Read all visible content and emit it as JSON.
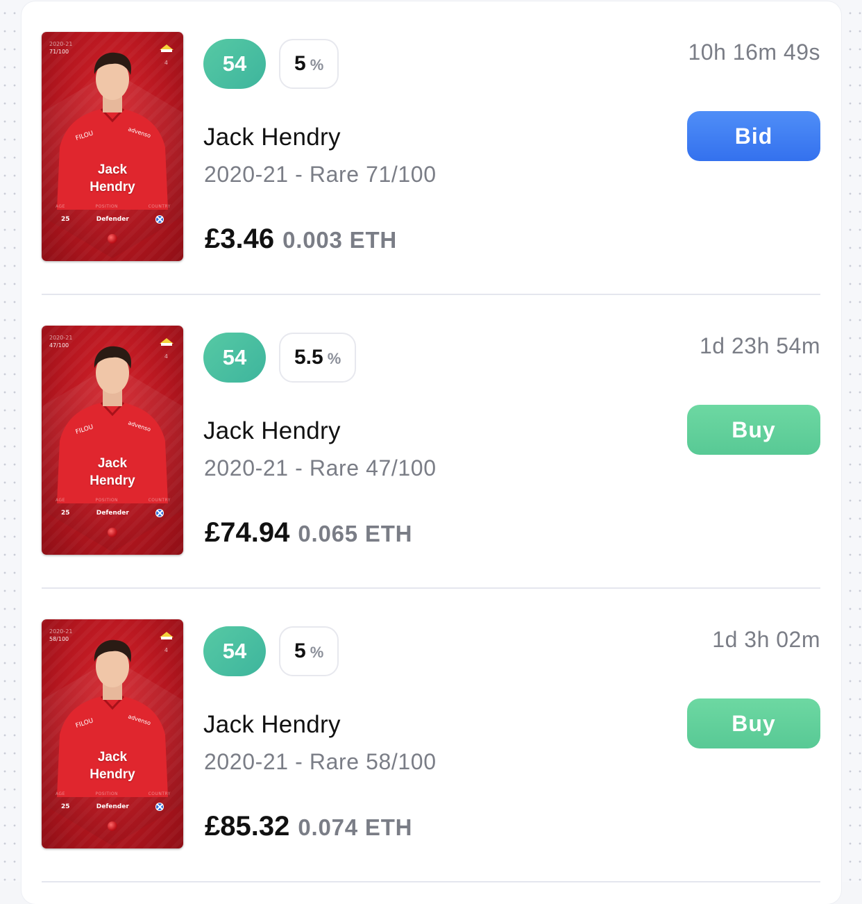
{
  "listings": [
    {
      "card": {
        "season": "2020-21",
        "serial": "71/100",
        "jersey_number": "4",
        "first_name": "Jack",
        "last_name": "Hendry",
        "age_label": "AGE",
        "position_label": "POSITION",
        "country_label": "COUNTRY",
        "age": "25",
        "position": "Defender",
        "color": "#c0161f"
      },
      "score": "54",
      "bonus": "5",
      "bonus_icon": "percent-icon",
      "name": "Jack Hendry",
      "edition": "2020-21 - Rare 71/100",
      "price_gbp": "£3.46",
      "price_eth": "0.003 ETH",
      "time_left": "10h 16m 49s",
      "action": "Bid",
      "action_type": "bid"
    },
    {
      "card": {
        "season": "2020-21",
        "serial": "47/100",
        "jersey_number": "4",
        "first_name": "Jack",
        "last_name": "Hendry",
        "age_label": "AGE",
        "position_label": "POSITION",
        "country_label": "COUNTRY",
        "age": "25",
        "position": "Defender",
        "color": "#c0161f"
      },
      "score": "54",
      "bonus": "5.5",
      "bonus_icon": "percent-icon",
      "name": "Jack Hendry",
      "edition": "2020-21 - Rare 47/100",
      "price_gbp": "£74.94",
      "price_eth": "0.065 ETH",
      "time_left": "1d 23h 54m",
      "action": "Buy",
      "action_type": "buy"
    },
    {
      "card": {
        "season": "2020-21",
        "serial": "58/100",
        "jersey_number": "4",
        "first_name": "Jack",
        "last_name": "Hendry",
        "age_label": "AGE",
        "position_label": "POSITION",
        "country_label": "COUNTRY",
        "age": "25",
        "position": "Defender",
        "color": "#c0161f"
      },
      "score": "54",
      "bonus": "5",
      "bonus_icon": "percent-icon",
      "name": "Jack Hendry",
      "edition": "2020-21 - Rare 58/100",
      "price_gbp": "£85.32",
      "price_eth": "0.074 ETH",
      "time_left": "1d 3h 02m",
      "action": "Buy",
      "action_type": "buy"
    }
  ],
  "colors": {
    "score_badge": "#4cbfa1",
    "bid_button": "#3f7ff2",
    "buy_button": "#62d09b",
    "muted_text": "#7a7d86"
  }
}
